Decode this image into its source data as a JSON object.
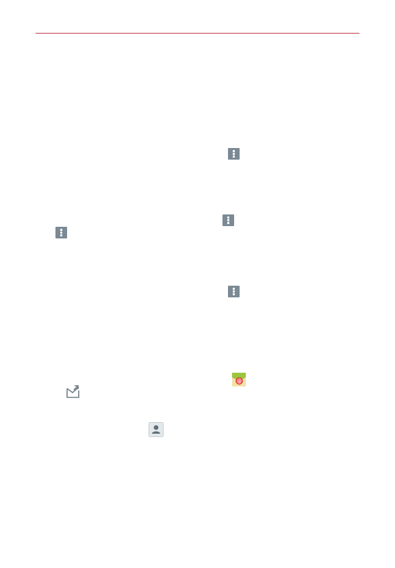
{
  "colors": {
    "header_rule": "#c0394a",
    "menu_icon_bg": "#7b8a94",
    "email_app_green": "#9bc53d",
    "email_app_yellow": "#f2c61f",
    "email_app_red": "#e53935",
    "contacts_icon_bg": "#e3e8ea"
  },
  "icons": [
    "menu-icon",
    "menu-icon",
    "menu-icon",
    "menu-icon",
    "email-app-icon",
    "compose-icon",
    "contacts-icon"
  ]
}
